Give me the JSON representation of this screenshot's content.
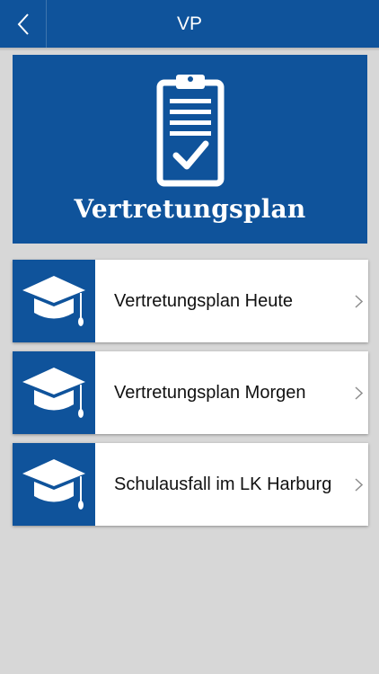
{
  "nav": {
    "title": "VP",
    "back_icon": "chevron-left-icon"
  },
  "hero": {
    "title": "Vertretungsplan",
    "icon": "clipboard-check-icon"
  },
  "menu": [
    {
      "label": "Vertretungsplan Heute",
      "icon": "graduation-cap-icon"
    },
    {
      "label": "Vertretungsplan Morgen",
      "icon": "graduation-cap-icon"
    },
    {
      "label": "Schulausfall im LK Harburg",
      "icon": "graduation-cap-icon"
    }
  ],
  "colors": {
    "brand": "#0f539b",
    "background": "#d7d7d7",
    "card": "#ffffff"
  }
}
